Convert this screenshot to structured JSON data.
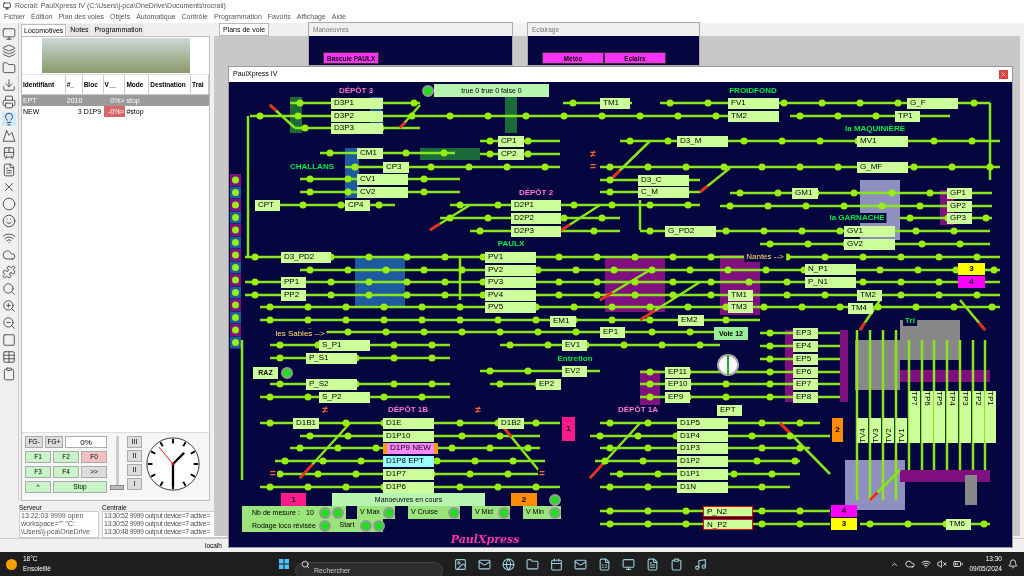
{
  "window": {
    "title": "Rocrail: PaulXpress IV (C:\\Users\\j-pca\\OneDrive\\Documents\\rocrail)"
  },
  "menu": [
    "Fichier",
    "Édition",
    "Plan des voies",
    "Objets",
    "Automatique",
    "Contrôle",
    "Programmation",
    "Favoris",
    "Affichage",
    "Aide"
  ],
  "left_tabs": [
    {
      "label": "Locomotives",
      "selected": true
    },
    {
      "label": "Notes",
      "selected": false
    },
    {
      "label": "Programmation",
      "selected": false
    }
  ],
  "loco_table": {
    "columns": [
      "Identifiant",
      "#_",
      "Bloc",
      "V__",
      "Mode",
      "Destination",
      "Trai"
    ],
    "rows": [
      {
        "cells": [
          "EPT",
          "2010",
          "",
          "0%>",
          "stop",
          "",
          ""
        ],
        "selected": true,
        "alert": false
      },
      {
        "cells": [
          "NEW",
          "3",
          "D1P9",
          "-0%>",
          "#stop",
          "",
          ""
        ],
        "selected": false,
        "alert": true
      }
    ]
  },
  "throttle": {
    "fg_buttons": [
      "FG-",
      "FG+"
    ],
    "speed": "0%",
    "functions": [
      {
        "label": "F1",
        "on": true
      },
      {
        "label": "F2",
        "on": true
      },
      {
        "label": "F0",
        "on": false
      },
      {
        "label": "F3",
        "on": true
      },
      {
        "label": "F4",
        "on": true
      },
      {
        "label": ">>"
      },
      {
        "label": "^",
        "on": true
      },
      {
        "label": "Stop",
        "on": true
      }
    ],
    "gears": [
      "III",
      "II",
      "II",
      "I"
    ],
    "level": 0
  },
  "server": {
    "label": "Serveur",
    "lines": [
      "13:22:03 9999 open",
      "workspace=\"\" \"C:",
      "\\Users\\j-pca\\OneDrive"
    ]
  },
  "central": {
    "label": "Centrale",
    "lines": [
      "13:30:52 9999 output device=7 active=",
      "13:30:52 9999 output device=7 active=",
      "13:30:48 9999 output device=7 active="
    ]
  },
  "status_bar": "localh",
  "right_tab": "Plans de voie",
  "bg_windows": [
    {
      "title": "Manoeuvres",
      "items": [
        "Bascule PAULX"
      ]
    },
    {
      "title": "Eclairage",
      "items": [
        "Météo",
        "Eclairs"
      ]
    }
  ],
  "plan_window": {
    "title": "PaulXpress IV",
    "status_text": "true 0 true 0 false 0",
    "titles": [
      {
        "text": "DÉPÔT 3",
        "kind": "depot"
      },
      {
        "text": "FROIDFOND",
        "kind": "station"
      },
      {
        "text": "la MAQUINIÈRE",
        "kind": "station"
      },
      {
        "text": "CHALLANS",
        "kind": "station"
      },
      {
        "text": "DÉPÔT 2",
        "kind": "depot"
      },
      {
        "text": "la GARNACHE",
        "kind": "station"
      },
      {
        "text": "PAULX",
        "kind": "station"
      },
      {
        "text": "Nantes -->",
        "kind": "direction"
      },
      {
        "text": "les Sables -->",
        "kind": "direction"
      },
      {
        "text": "Entretion",
        "kind": "station"
      },
      {
        "text": "DÉPÔT 1B",
        "kind": "depot"
      },
      {
        "text": "DÉPÔT 1A",
        "kind": "depot"
      },
      {
        "text": "Tri",
        "kind": "station"
      }
    ],
    "blocks": [
      {
        "label": "D3P1",
        "kind": "free"
      },
      {
        "label": "TM1",
        "kind": "free"
      },
      {
        "label": "FV1",
        "kind": "free"
      },
      {
        "label": "G_F",
        "kind": "free"
      },
      {
        "label": "D3P2",
        "kind": "free"
      },
      {
        "label": "TM2",
        "kind": "free"
      },
      {
        "label": "TP1",
        "kind": "free"
      },
      {
        "label": "D3P3",
        "kind": "free"
      },
      {
        "label": "CP1",
        "kind": "free"
      },
      {
        "label": "D3_M",
        "kind": "free"
      },
      {
        "label": "MV1",
        "kind": "free"
      },
      {
        "label": "CM1",
        "kind": "free"
      },
      {
        "label": "CP2",
        "kind": "free"
      },
      {
        "label": "CP3",
        "kind": "free"
      },
      {
        "label": "G_MF",
        "kind": "free"
      },
      {
        "label": "CV1",
        "kind": "free"
      },
      {
        "label": "D3_C",
        "kind": "free"
      },
      {
        "label": "CV2",
        "kind": "free"
      },
      {
        "label": "C_M",
        "kind": "free"
      },
      {
        "label": "GM1",
        "kind": "free"
      },
      {
        "label": "GP1",
        "kind": "free"
      },
      {
        "label": "CPT",
        "kind": "free"
      },
      {
        "label": "CP4",
        "kind": "free"
      },
      {
        "label": "D2P1",
        "kind": "free"
      },
      {
        "label": "GP2",
        "kind": "free"
      },
      {
        "label": "D2P2",
        "kind": "free"
      },
      {
        "label": "GP3",
        "kind": "free"
      },
      {
        "label": "D2P3",
        "kind": "free"
      },
      {
        "label": "G_PD2",
        "kind": "free"
      },
      {
        "label": "GV1",
        "kind": "free"
      },
      {
        "label": "GV2",
        "kind": "free"
      },
      {
        "label": "D3_PD2",
        "kind": "free"
      },
      {
        "label": "PV1",
        "kind": "free"
      },
      {
        "label": "PV2",
        "kind": "free"
      },
      {
        "label": "N_P1",
        "kind": "free"
      },
      {
        "label": "PP1",
        "kind": "free"
      },
      {
        "label": "PV3",
        "kind": "free"
      },
      {
        "label": "P_N1",
        "kind": "free"
      },
      {
        "label": "PP2",
        "kind": "free"
      },
      {
        "label": "PV4",
        "kind": "free"
      },
      {
        "label": "TM1",
        "kind": "free"
      },
      {
        "label": "TM2",
        "kind": "free"
      },
      {
        "label": "PV5",
        "kind": "free"
      },
      {
        "label": "TM3",
        "kind": "free"
      },
      {
        "label": "TM4",
        "kind": "free"
      },
      {
        "label": "EM1",
        "kind": "free"
      },
      {
        "label": "EM2",
        "kind": "free"
      },
      {
        "label": "EP1",
        "kind": "free"
      },
      {
        "label": "EP3",
        "kind": "free"
      },
      {
        "label": "S_P1",
        "kind": "free"
      },
      {
        "label": "EV1",
        "kind": "free"
      },
      {
        "label": "EP4",
        "kind": "free"
      },
      {
        "label": "P_S1",
        "kind": "free"
      },
      {
        "label": "EP5",
        "kind": "free"
      },
      {
        "label": "EV2",
        "kind": "free"
      },
      {
        "label": "EP11",
        "kind": "free"
      },
      {
        "label": "EP6",
        "kind": "free"
      },
      {
        "label": "P_S2",
        "kind": "free"
      },
      {
        "label": "EP2",
        "kind": "free"
      },
      {
        "label": "EP10",
        "kind": "free"
      },
      {
        "label": "EP7",
        "kind": "free"
      },
      {
        "label": "S_P2",
        "kind": "free"
      },
      {
        "label": "EP9",
        "kind": "free"
      },
      {
        "label": "EP8",
        "kind": "free"
      },
      {
        "label": "EPT",
        "kind": "free"
      },
      {
        "label": "D1B1",
        "kind": "free"
      },
      {
        "label": "D1E",
        "kind": "free"
      },
      {
        "label": "D1B2",
        "kind": "free"
      },
      {
        "label": "D1P5",
        "kind": "free"
      },
      {
        "label": "D1P10",
        "kind": "free"
      },
      {
        "label": "D1P4",
        "kind": "free"
      },
      {
        "label": "D1P9 NEW",
        "kind": "reserved"
      },
      {
        "label": "D1P3",
        "kind": "free"
      },
      {
        "label": "D1P8 EPT",
        "kind": "occupied"
      },
      {
        "label": "D1P2",
        "kind": "free"
      },
      {
        "label": "D1P7",
        "kind": "free"
      },
      {
        "label": "D1P1",
        "kind": "free"
      },
      {
        "label": "D1P6",
        "kind": "free"
      },
      {
        "label": "D1N",
        "kind": "free"
      },
      {
        "label": "P_N2",
        "kind": "locked"
      },
      {
        "label": "N_P2",
        "kind": "locked"
      },
      {
        "label": "TM6",
        "kind": "free"
      }
    ],
    "tri_blocks": [
      {
        "label": "TV4",
        "kind": "up"
      },
      {
        "label": "TV3",
        "kind": "up"
      },
      {
        "label": "TV2",
        "kind": "up"
      },
      {
        "label": "TV1",
        "kind": "up"
      },
      {
        "label": "TP7",
        "kind": "down"
      },
      {
        "label": "TP6",
        "kind": "down"
      },
      {
        "label": "TP5",
        "kind": "down"
      },
      {
        "label": "TP4",
        "kind": "down"
      },
      {
        "label": "TP3",
        "kind": "down"
      },
      {
        "label": "TP2",
        "kind": "down"
      },
      {
        "label": "TP1",
        "kind": "down"
      }
    ],
    "markers": [
      {
        "label": "3",
        "color": "#ffff00"
      },
      {
        "label": "4",
        "color": "#ff00ff"
      },
      {
        "label": "1",
        "color": "#ff1a8c"
      },
      {
        "label": "2",
        "color": "#ff8c00"
      },
      {
        "label": "1",
        "color": "#ff1a8c"
      },
      {
        "label": "2",
        "color": "#ff8c00"
      },
      {
        "label": "4",
        "color": "#ff00ff"
      },
      {
        "label": "3",
        "color": "#ffff00"
      }
    ],
    "symbols": [
      "≠",
      "=",
      "≠",
      "≠",
      "=",
      "="
    ],
    "voie_label": "Voie 12",
    "raz_button": "RAZ",
    "manoeuvres_label": "Manoeuvres en cours",
    "measure": {
      "label": "Nb de mesure :",
      "count": "10",
      "speeds": [
        "V Max",
        "V Cruise",
        "V Mid",
        "V Min"
      ],
      "run_label": "Rodage loco révisée",
      "start": "Start"
    },
    "logo": "PaulXpress"
  },
  "taskbar": {
    "weather": {
      "temp": "18°C",
      "text": "Ensoleillé"
    },
    "search": {
      "placeholder": "Rechercher"
    },
    "time": "13:30",
    "date": "09/05/2024"
  }
}
